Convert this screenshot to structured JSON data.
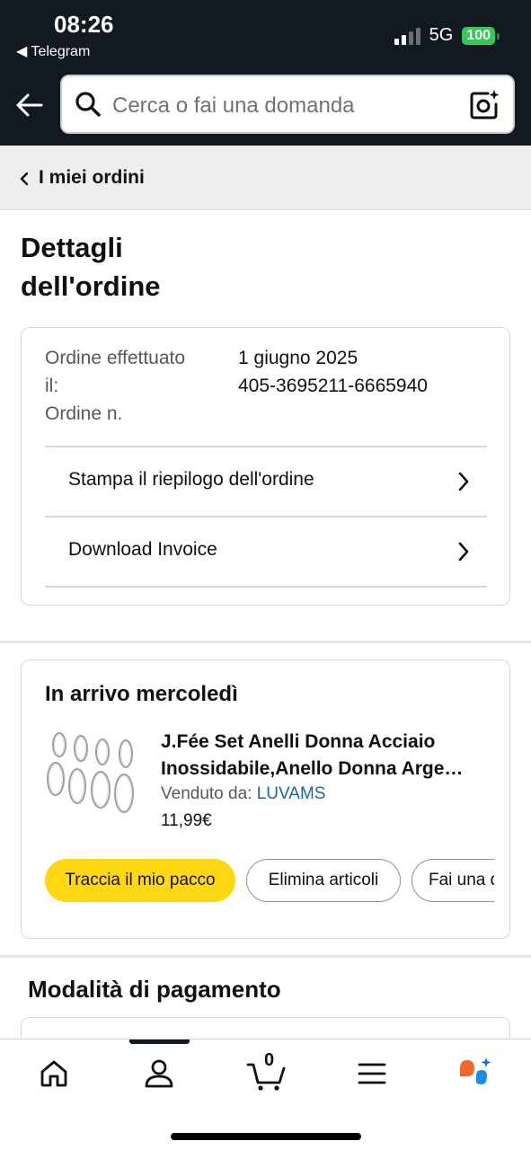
{
  "status_bar": {
    "time": "08:26",
    "back_app": "◀ Telegram",
    "network": "5G",
    "battery": "100"
  },
  "header": {
    "search_placeholder": "Cerca o fai una domanda"
  },
  "breadcrumb": {
    "label": "I miei ordini"
  },
  "page": {
    "title": "Dettagli dell'ordine"
  },
  "order_info": {
    "date_label_line1": "Ordine effettuato",
    "date_label_line2": "il:",
    "date_value": "1 giugno 2025",
    "number_label": "Ordine n.",
    "number_value": "405-3695211-6665940",
    "links": [
      {
        "label": "Stampa il riepilogo dell'ordine"
      },
      {
        "label": "Download Invoice"
      }
    ]
  },
  "shipment": {
    "arrival": "In arrivo mercoledì",
    "product_title_line1": "J.Fée Set Anelli Donna Acciaio",
    "product_title_line2": "Inossidabile,Anello Donna Arge…",
    "sold_by_label": "Venduto da:",
    "seller": "LUVAMS",
    "price": "11,99€",
    "buttons": [
      {
        "label": "Traccia il mio pacco"
      },
      {
        "label": "Elimina articoli"
      },
      {
        "label": "Fai una d"
      }
    ]
  },
  "payment": {
    "title": "Modalità di pagamento"
  },
  "bottom_nav": {
    "cart_count": "0",
    "items": [
      "home-icon",
      "account-icon",
      "cart-icon",
      "menu-icon",
      "rufus-icon"
    ]
  },
  "colors": {
    "header_bg": "#131921",
    "primary_button": "#ffd814",
    "link": "#2162a1",
    "battery": "#34c759"
  }
}
